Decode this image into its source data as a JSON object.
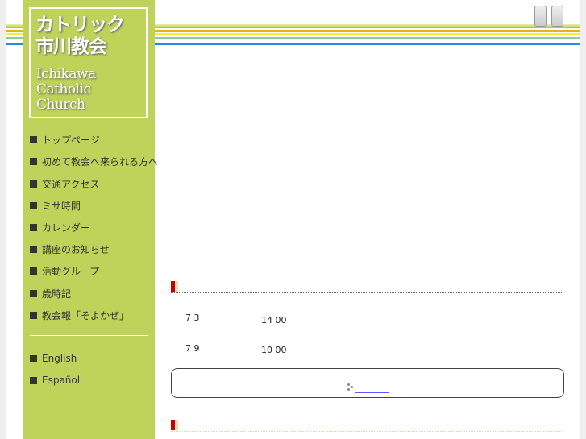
{
  "logo": {
    "jp_line1": "カトリック",
    "jp_line2": "市川教会",
    "en_line1": "Ichikawa",
    "en_line2": "Catholic",
    "en_line3": "Church"
  },
  "nav": {
    "items": [
      {
        "label": "トップページ"
      },
      {
        "label": "初めて教会へ来られる方へ"
      },
      {
        "label": "交通アクセス"
      },
      {
        "label": "ミサ時間"
      },
      {
        "label": "カレンダー"
      },
      {
        "label": "講座のお知らせ"
      },
      {
        "label": "活動グループ"
      },
      {
        "label": "歳時記"
      },
      {
        "label": "教会報「そよかぜ」"
      }
    ],
    "lang": [
      {
        "label": "English"
      },
      {
        "label": "Español"
      }
    ]
  },
  "colors": {
    "sidebar": "#bfd35a",
    "accent": "#cc0000",
    "link": "#5a5aff"
  },
  "events": [
    {
      "date": "7 3",
      "time": "14 00"
    },
    {
      "date": "7 9",
      "time": "10 00"
    }
  ]
}
